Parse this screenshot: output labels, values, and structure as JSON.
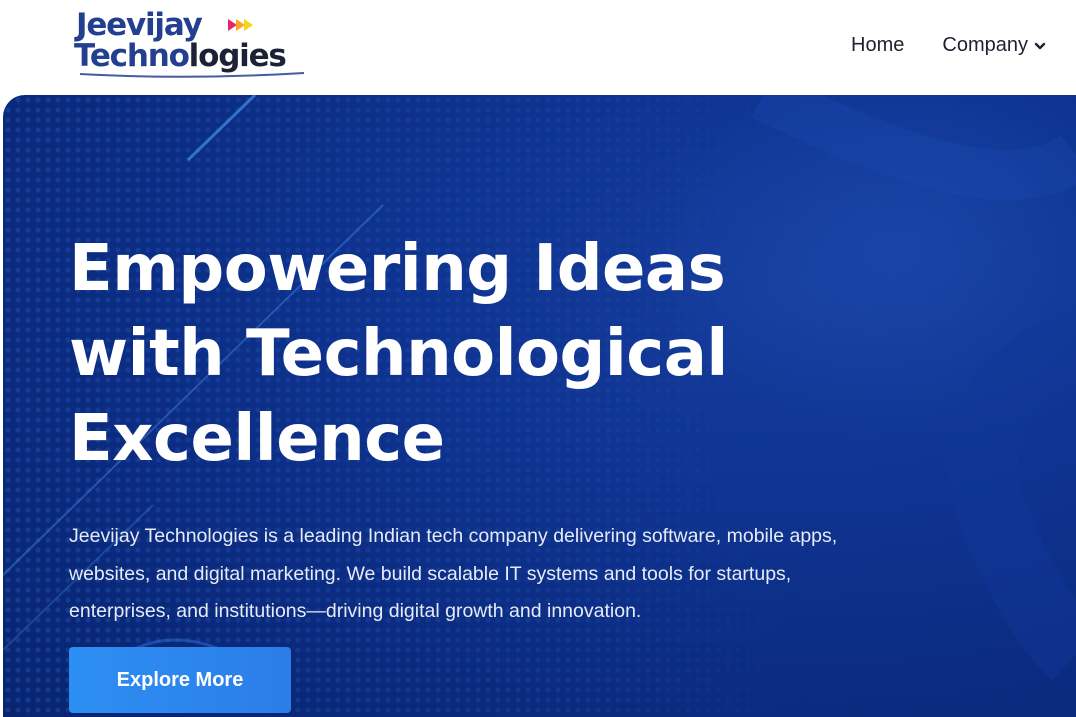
{
  "header": {
    "logo": {
      "line1": "Jeevijay",
      "line2_part1": "Techno",
      "line2_part2": "logies",
      "arrow_colors": [
        "#e8246f",
        "#f6a623",
        "#f7d31e"
      ]
    },
    "nav": {
      "home_label": "Home",
      "company_label": "Company"
    }
  },
  "hero": {
    "title": "Empowering Ideas with Technological Excellence",
    "description": "Jeevijay Technologies is a leading Indian tech company delivering software, mobile apps, websites, and digital marketing. We build scalable IT systems and tools for startups, enterprises, and institutions—driving digital growth and innovation.",
    "cta_label": "Explore More"
  },
  "colors": {
    "brand_blue": "#233f8f",
    "brand_dark": "#1b2235",
    "hero_bg": "#0e3390",
    "cta": "#2d8ff2",
    "nav_text": "#1e2130"
  },
  "icons": {
    "dropdown": "chevron-down-icon",
    "logo_arrows": "triple-arrow-icon"
  }
}
